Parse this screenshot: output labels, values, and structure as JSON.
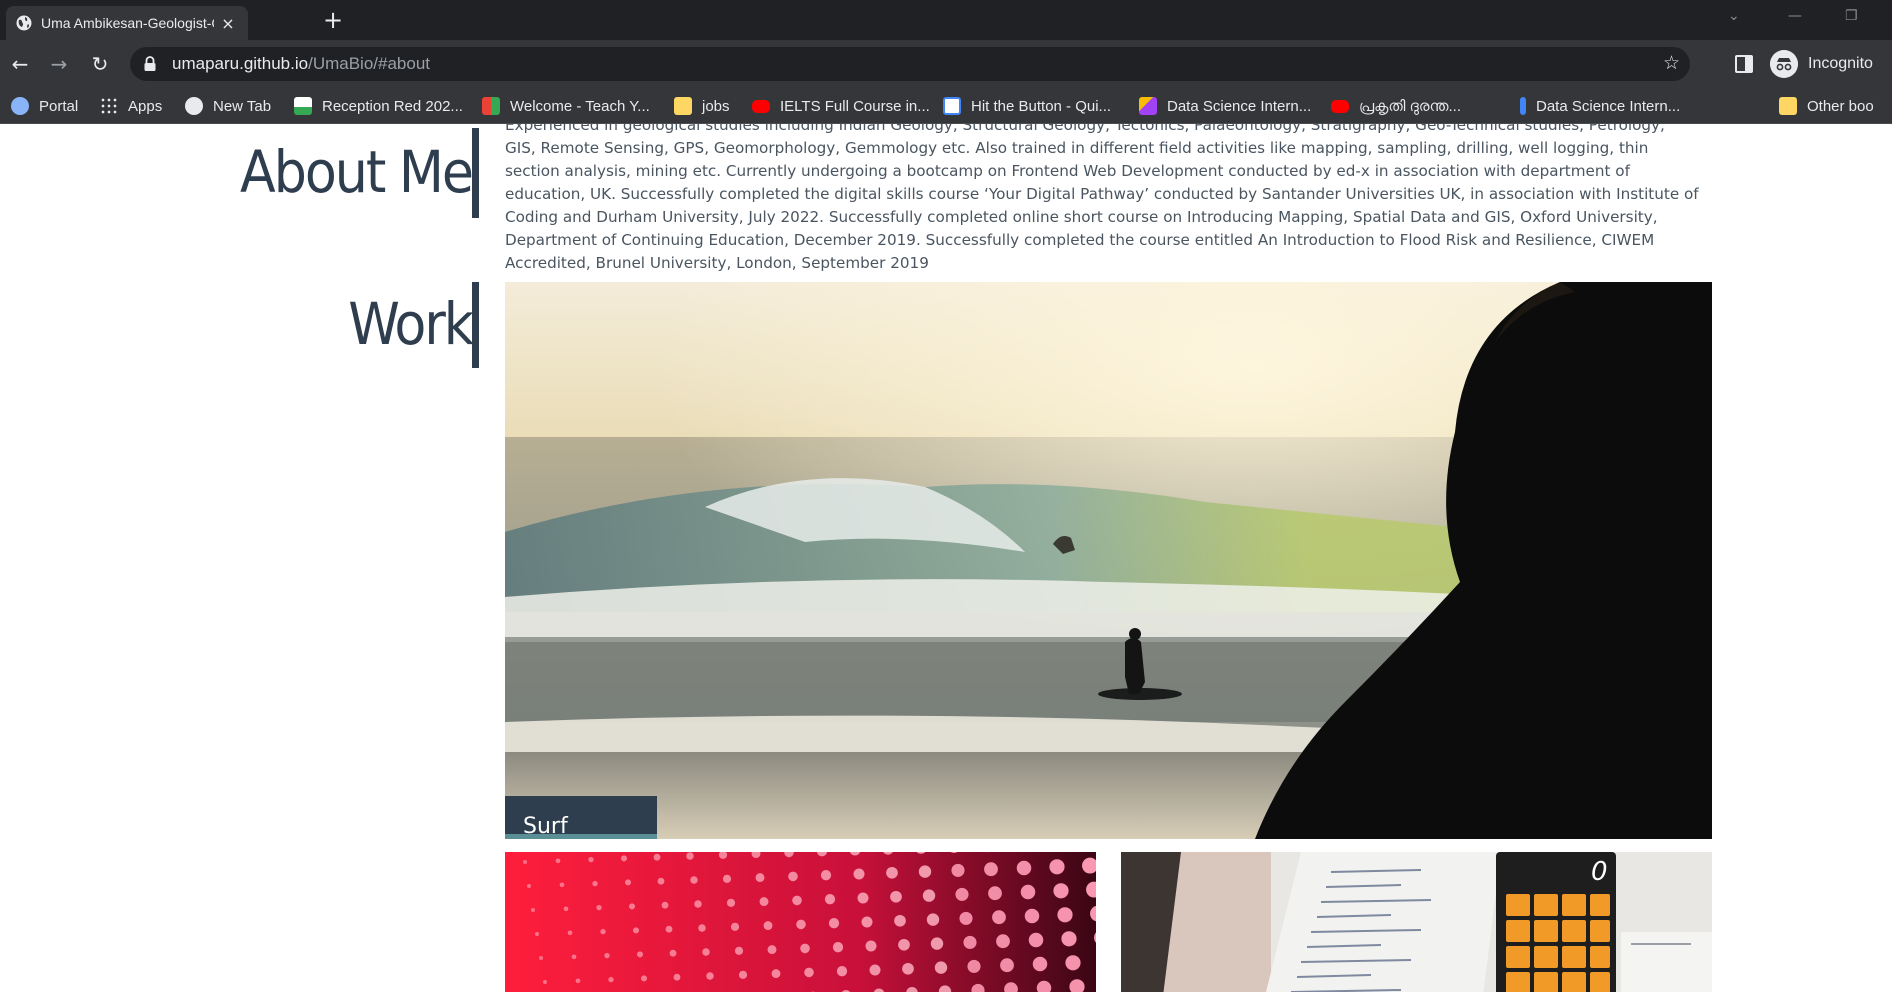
{
  "browser": {
    "tab_title": "Uma Ambikesan-Geologist-GIS-F",
    "tab_close": "×",
    "new_tab": "+",
    "url_host": "umaparu.github.io",
    "url_path": "/UmaBio/#about",
    "profile_label": "Incognito",
    "bookmarks": [
      {
        "label": "Portal",
        "icon": "portal-icon",
        "color": "#8ab4f8"
      },
      {
        "label": "Apps",
        "icon": "apps-grid-icon",
        "color": "#e8eaed"
      },
      {
        "label": "New Tab",
        "icon": "globe-icon",
        "color": "#e8eaed"
      },
      {
        "label": "Reception Red 202...",
        "icon": "image-icon",
        "color": "#34a853"
      },
      {
        "label": "Welcome - Teach Y...",
        "icon": "teach-icon",
        "color": "#ea4335"
      },
      {
        "label": "jobs",
        "icon": "folder-icon",
        "color": "#fdd663"
      },
      {
        "label": "IELTS Full Course in...",
        "icon": "youtube-icon",
        "color": "#ff0000"
      },
      {
        "label": "Hit the Button - Qui...",
        "icon": "checkbox-icon",
        "color": "#ffffff"
      },
      {
        "label": "Data Science Intern...",
        "icon": "ds-icon",
        "color": "#a142f4"
      },
      {
        "label": "പ്രകൃതി ദുരന്ത...",
        "icon": "youtube-icon",
        "color": "#ff0000"
      },
      {
        "label": "Data Science Intern...",
        "icon": "info-icon",
        "color": "#4285f4"
      },
      {
        "label": "Other boo",
        "icon": "folder-icon",
        "color": "#fdd663"
      }
    ]
  },
  "page": {
    "about": {
      "heading": "About Me",
      "text": "Experienced in geological studies including Indian Geology, Structural Geology, Tectonics, Palaeontology, Stratigraphy, Geo-Technical studies, Petrology, GIS, Remote Sensing, GPS, Geomorphology, Gemmology etc. Also trained in different field activities like mapping, sampling, drilling, well logging, thin section analysis, mining etc. Currently undergoing a bootcamp on Frontend Web Development conducted by ed-x in association with department of education, UK. Successfully completed the digital skills course ‘Your Digital Pathway’ conducted by Santander Universities UK, in association with Institute of Coding and Durham University, July 2022. Successfully completed online short course on Introducing Mapping, Spatial Data and GIS, Oxford University, Department of Continuing Education, December 2019. Successfully completed the course entitled An Introduction to Flood Risk and Resilience, CIWEM Accredited, Brunel University, London, September 2019"
    },
    "work": {
      "heading": "Work",
      "main_caption": "Surf",
      "calculator_display": "0"
    }
  },
  "colors": {
    "heading": "#2e3e4f",
    "caption_accent": "#5a8f96",
    "chrome_dark": "#202124",
    "chrome_mid": "#35363a"
  }
}
